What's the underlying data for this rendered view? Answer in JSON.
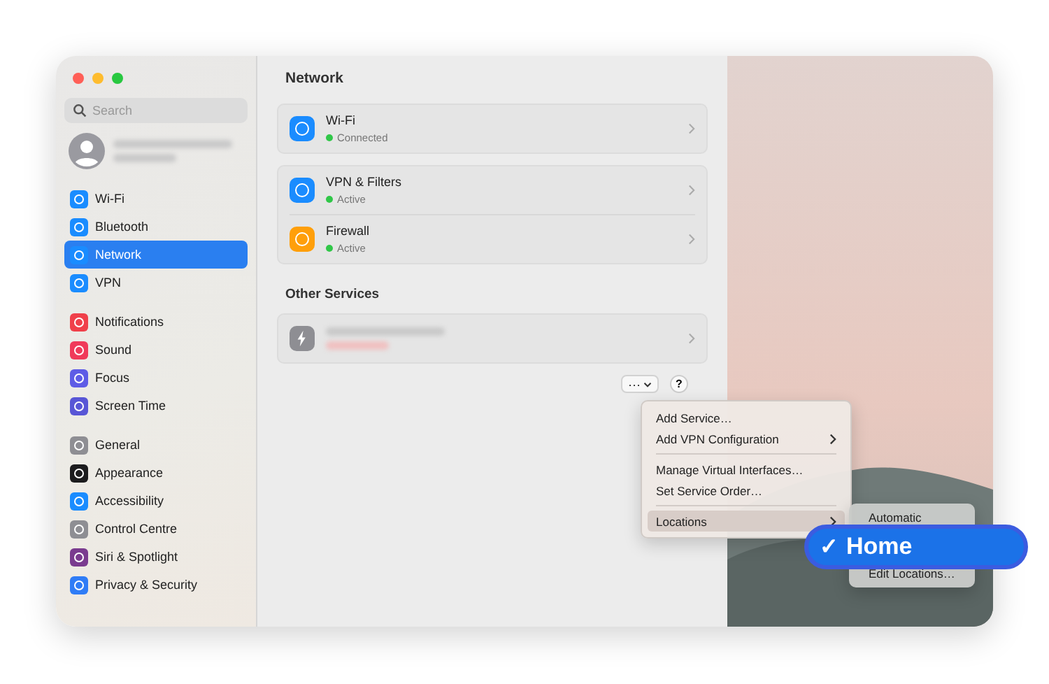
{
  "window": {
    "title": "Network"
  },
  "sidebar": {
    "search": {
      "placeholder": "Search"
    },
    "groups": [
      {
        "items": [
          {
            "label": "Wi-Fi",
            "selected": false
          },
          {
            "label": "Bluetooth",
            "selected": false
          },
          {
            "label": "Network",
            "selected": true
          },
          {
            "label": "VPN",
            "selected": false
          }
        ]
      },
      {
        "items": [
          {
            "label": "Notifications",
            "selected": false
          },
          {
            "label": "Sound",
            "selected": false
          },
          {
            "label": "Focus",
            "selected": false
          },
          {
            "label": "Screen Time",
            "selected": false
          }
        ]
      },
      {
        "items": [
          {
            "label": "General",
            "selected": false
          },
          {
            "label": "Appearance",
            "selected": false
          },
          {
            "label": "Accessibility",
            "selected": false
          },
          {
            "label": "Control Centre",
            "selected": false
          },
          {
            "label": "Siri & Spotlight",
            "selected": false
          },
          {
            "label": "Privacy & Security",
            "selected": false
          }
        ]
      }
    ]
  },
  "services": [
    {
      "items": [
        {
          "name": "Wi-Fi",
          "status": "Connected",
          "color": "#30c748"
        }
      ]
    },
    {
      "items": [
        {
          "name": "VPN & Filters",
          "status": "Active",
          "color": "#30c748"
        },
        {
          "name": "Firewall",
          "status": "Active",
          "color": "#30c748"
        }
      ]
    }
  ],
  "other_services": {
    "heading": "Other Services"
  },
  "toolbar": {
    "more": "···",
    "help": "?"
  },
  "menu": {
    "groups": [
      [
        {
          "label": "Add Service…",
          "submenu": false,
          "selected": false
        },
        {
          "label": "Add VPN Configuration",
          "submenu": true,
          "selected": false
        }
      ],
      [
        {
          "label": "Manage Virtual Interfaces…",
          "submenu": false,
          "selected": false
        },
        {
          "label": "Set Service Order…",
          "submenu": false,
          "selected": false
        }
      ],
      [
        {
          "label": "Locations",
          "submenu": true,
          "selected": true
        }
      ]
    ]
  },
  "locations_menu": {
    "items": [
      {
        "label": "Automatic",
        "selected": false
      },
      {
        "label": "Edit Locations…",
        "selected": false
      }
    ]
  },
  "callout": {
    "check": "✓",
    "label": "Home",
    "selected": true
  }
}
